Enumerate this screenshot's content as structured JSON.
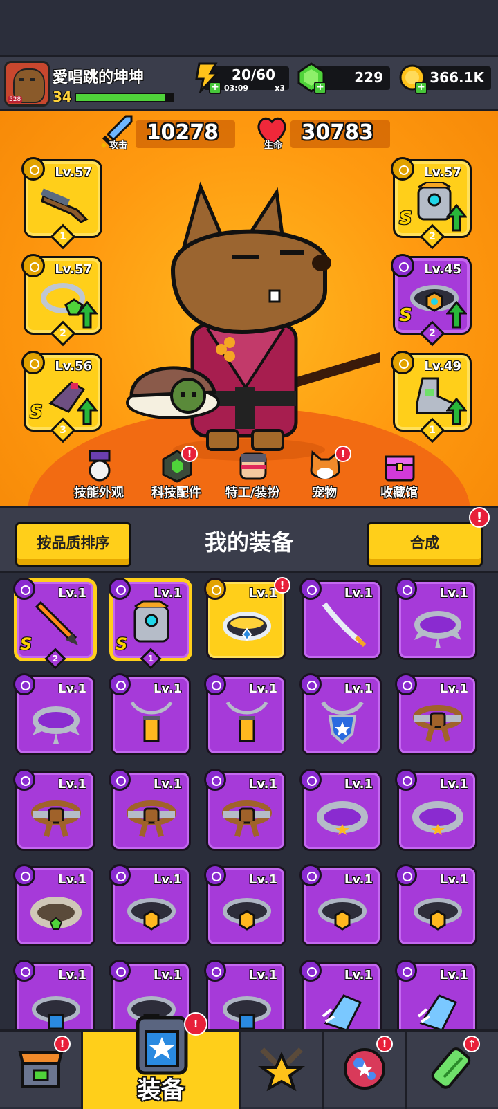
{
  "player": {
    "name": "愛唱跳的坤坤",
    "level": "34",
    "avatar_badge": "528",
    "xp_progress": 0.92
  },
  "resources": {
    "energy": {
      "value": "20/60",
      "timer": "03:09",
      "multiplier": "x3",
      "icon": "energy-bolt-icon"
    },
    "gems": {
      "value": "229",
      "icon": "green-gem-icon"
    },
    "coins": {
      "value": "366.1K",
      "icon": "gold-coin-icon"
    }
  },
  "stats": {
    "attack": {
      "label": "攻击",
      "value": "10278",
      "icon": "sword-icon"
    },
    "hp": {
      "label": "生命",
      "value": "30783",
      "icon": "heart-icon"
    }
  },
  "equipped": [
    {
      "slot": "weapon",
      "level": "Lv.57",
      "count": "1",
      "rarity": "gold",
      "s": "",
      "upgrade": false,
      "icon": "shotgun-icon"
    },
    {
      "slot": "necklace",
      "level": "Lv.57",
      "count": "2",
      "rarity": "gold",
      "s": "",
      "upgrade": true,
      "icon": "emerald-ring-icon"
    },
    {
      "slot": "gloves",
      "level": "Lv.56",
      "count": "3",
      "rarity": "gold",
      "s": "S",
      "upgrade": true,
      "icon": "mech-glove-icon"
    },
    {
      "slot": "armor",
      "level": "Lv.57",
      "count": "2",
      "rarity": "gold",
      "s": "S",
      "upgrade": true,
      "icon": "mech-armor-icon"
    },
    {
      "slot": "belt",
      "level": "Lv.45",
      "count": "2",
      "rarity": "purple",
      "s": "S",
      "upgrade": true,
      "icon": "hex-belt-icon"
    },
    {
      "slot": "boots",
      "level": "Lv.49",
      "count": "1",
      "rarity": "gold",
      "s": "",
      "upgrade": true,
      "icon": "mech-boot-icon"
    }
  ],
  "menu": [
    {
      "label": "技能外观",
      "icon": "skill-skin-icon",
      "alert": false
    },
    {
      "label": "科技配件",
      "icon": "tech-part-icon",
      "alert": true
    },
    {
      "label": "特工/装扮",
      "icon": "agent-icon",
      "alert": false
    },
    {
      "label": "宠物",
      "icon": "pet-shiba-icon",
      "alert": true
    },
    {
      "label": "收藏馆",
      "icon": "collection-chest-icon",
      "alert": false
    }
  ],
  "equipment_panel": {
    "title": "我的装备",
    "sort_button": "按品质排序",
    "merge_button": "合成",
    "merge_alert": "!"
  },
  "inventory": [
    {
      "level": "Lv.1",
      "rarity": "purple-s",
      "s": "S",
      "count": "2",
      "icon": "flame-sword-icon"
    },
    {
      "level": "Lv.1",
      "rarity": "purple-s",
      "s": "S",
      "count": "1",
      "icon": "mech-armor-icon"
    },
    {
      "level": "Lv.1",
      "rarity": "gold",
      "s": "",
      "count": "",
      "icon": "star-belt-icon"
    },
    {
      "level": "Lv.1",
      "rarity": "purple",
      "s": "",
      "count": "",
      "icon": "katana-icon"
    },
    {
      "level": "Lv.1",
      "rarity": "purple",
      "s": "",
      "count": "",
      "icon": "spiked-collar-icon"
    },
    {
      "level": "Lv.1",
      "rarity": "purple",
      "s": "",
      "count": "",
      "icon": "spiked-collar-icon"
    },
    {
      "level": "Lv.1",
      "rarity": "purple",
      "s": "",
      "count": "",
      "icon": "lantern-necklace-icon"
    },
    {
      "level": "Lv.1",
      "rarity": "purple",
      "s": "",
      "count": "",
      "icon": "lantern-necklace-icon"
    },
    {
      "level": "Lv.1",
      "rarity": "purple",
      "s": "",
      "count": "",
      "icon": "shield-pendant-icon"
    },
    {
      "level": "Lv.1",
      "rarity": "purple",
      "s": "",
      "count": "",
      "icon": "knot-belt-icon"
    },
    {
      "level": "Lv.1",
      "rarity": "purple",
      "s": "",
      "count": "",
      "icon": "knot-belt-icon"
    },
    {
      "level": "Lv.1",
      "rarity": "purple",
      "s": "",
      "count": "",
      "icon": "knot-belt-icon"
    },
    {
      "level": "Lv.1",
      "rarity": "purple",
      "s": "",
      "count": "",
      "icon": "knot-belt-icon"
    },
    {
      "level": "Lv.1",
      "rarity": "purple",
      "s": "",
      "count": "",
      "icon": "star-ring-belt-icon"
    },
    {
      "level": "Lv.1",
      "rarity": "purple",
      "s": "",
      "count": "",
      "icon": "star-ring-belt-icon"
    },
    {
      "level": "Lv.1",
      "rarity": "purple",
      "s": "",
      "count": "",
      "icon": "gem-belt-icon"
    },
    {
      "level": "Lv.1",
      "rarity": "purple",
      "s": "",
      "count": "",
      "icon": "hex-belt-icon"
    },
    {
      "level": "Lv.1",
      "rarity": "purple",
      "s": "",
      "count": "",
      "icon": "hex-belt-icon"
    },
    {
      "level": "Lv.1",
      "rarity": "purple",
      "s": "",
      "count": "",
      "icon": "hex-belt-icon"
    },
    {
      "level": "Lv.1",
      "rarity": "purple",
      "s": "",
      "count": "",
      "icon": "hex-belt-icon"
    },
    {
      "level": "Lv.1",
      "rarity": "purple",
      "s": "",
      "count": "",
      "icon": "blue-belt-icon"
    },
    {
      "level": "Lv.1",
      "rarity": "purple",
      "s": "",
      "count": "",
      "icon": "blue-belt-icon"
    },
    {
      "level": "Lv.1",
      "rarity": "purple",
      "s": "",
      "count": "",
      "icon": "blue-belt-icon"
    },
    {
      "level": "Lv.1",
      "rarity": "purple",
      "s": "",
      "count": "",
      "icon": "ice-glove-icon"
    },
    {
      "level": "Lv.1",
      "rarity": "purple",
      "s": "",
      "count": "",
      "icon": "ice-glove-icon"
    }
  ],
  "tabs": [
    {
      "label": "",
      "icon": "shop-icon",
      "alert": true,
      "active": false
    },
    {
      "label": "装备",
      "icon": "equipment-icon",
      "alert": true,
      "active": true
    },
    {
      "label": "",
      "icon": "battle-star-icon",
      "alert": false,
      "active": false
    },
    {
      "label": "",
      "icon": "planet-icon",
      "alert": true,
      "active": false
    },
    {
      "label": "",
      "icon": "gene-capsule-icon",
      "alert": true,
      "active": false
    }
  ],
  "colors": {
    "gold_rarity": "#ffcf1a",
    "purple_rarity": "#a63ad9",
    "background_orange": "#ff9a10",
    "alert_red": "#e8203a"
  }
}
